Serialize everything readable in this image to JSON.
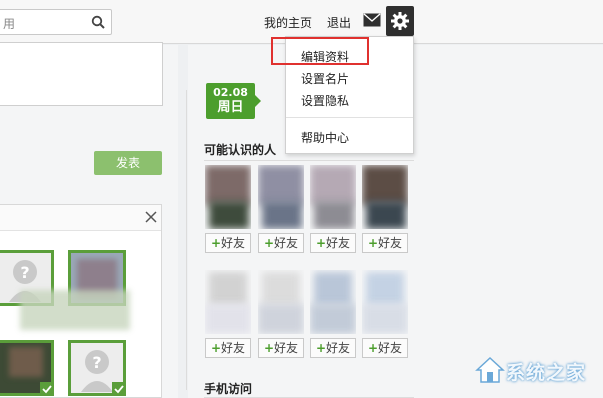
{
  "header": {
    "search_placeholder": "用",
    "nav": {
      "home": "我的主页",
      "logout": "退出"
    }
  },
  "settings_menu": {
    "items": [
      "编辑资料",
      "设置名片",
      "设置隐私"
    ],
    "help": "帮助中心",
    "highlighted": "编辑资料",
    "highlight_color": "#e0312f"
  },
  "composer": {
    "post_button": "发表"
  },
  "date_badge": {
    "date": "02.08",
    "weekday": "周日"
  },
  "people_you_may_know": {
    "title": "可能认识的人",
    "add_label": "好友"
  },
  "mobile_section": {
    "title": "手机访问"
  },
  "watermark": {
    "text": "系统之家"
  },
  "colors": {
    "accent_green": "#4c9e2d",
    "post_button": "#8cc06e",
    "gear_bg": "#2f2f2f"
  }
}
